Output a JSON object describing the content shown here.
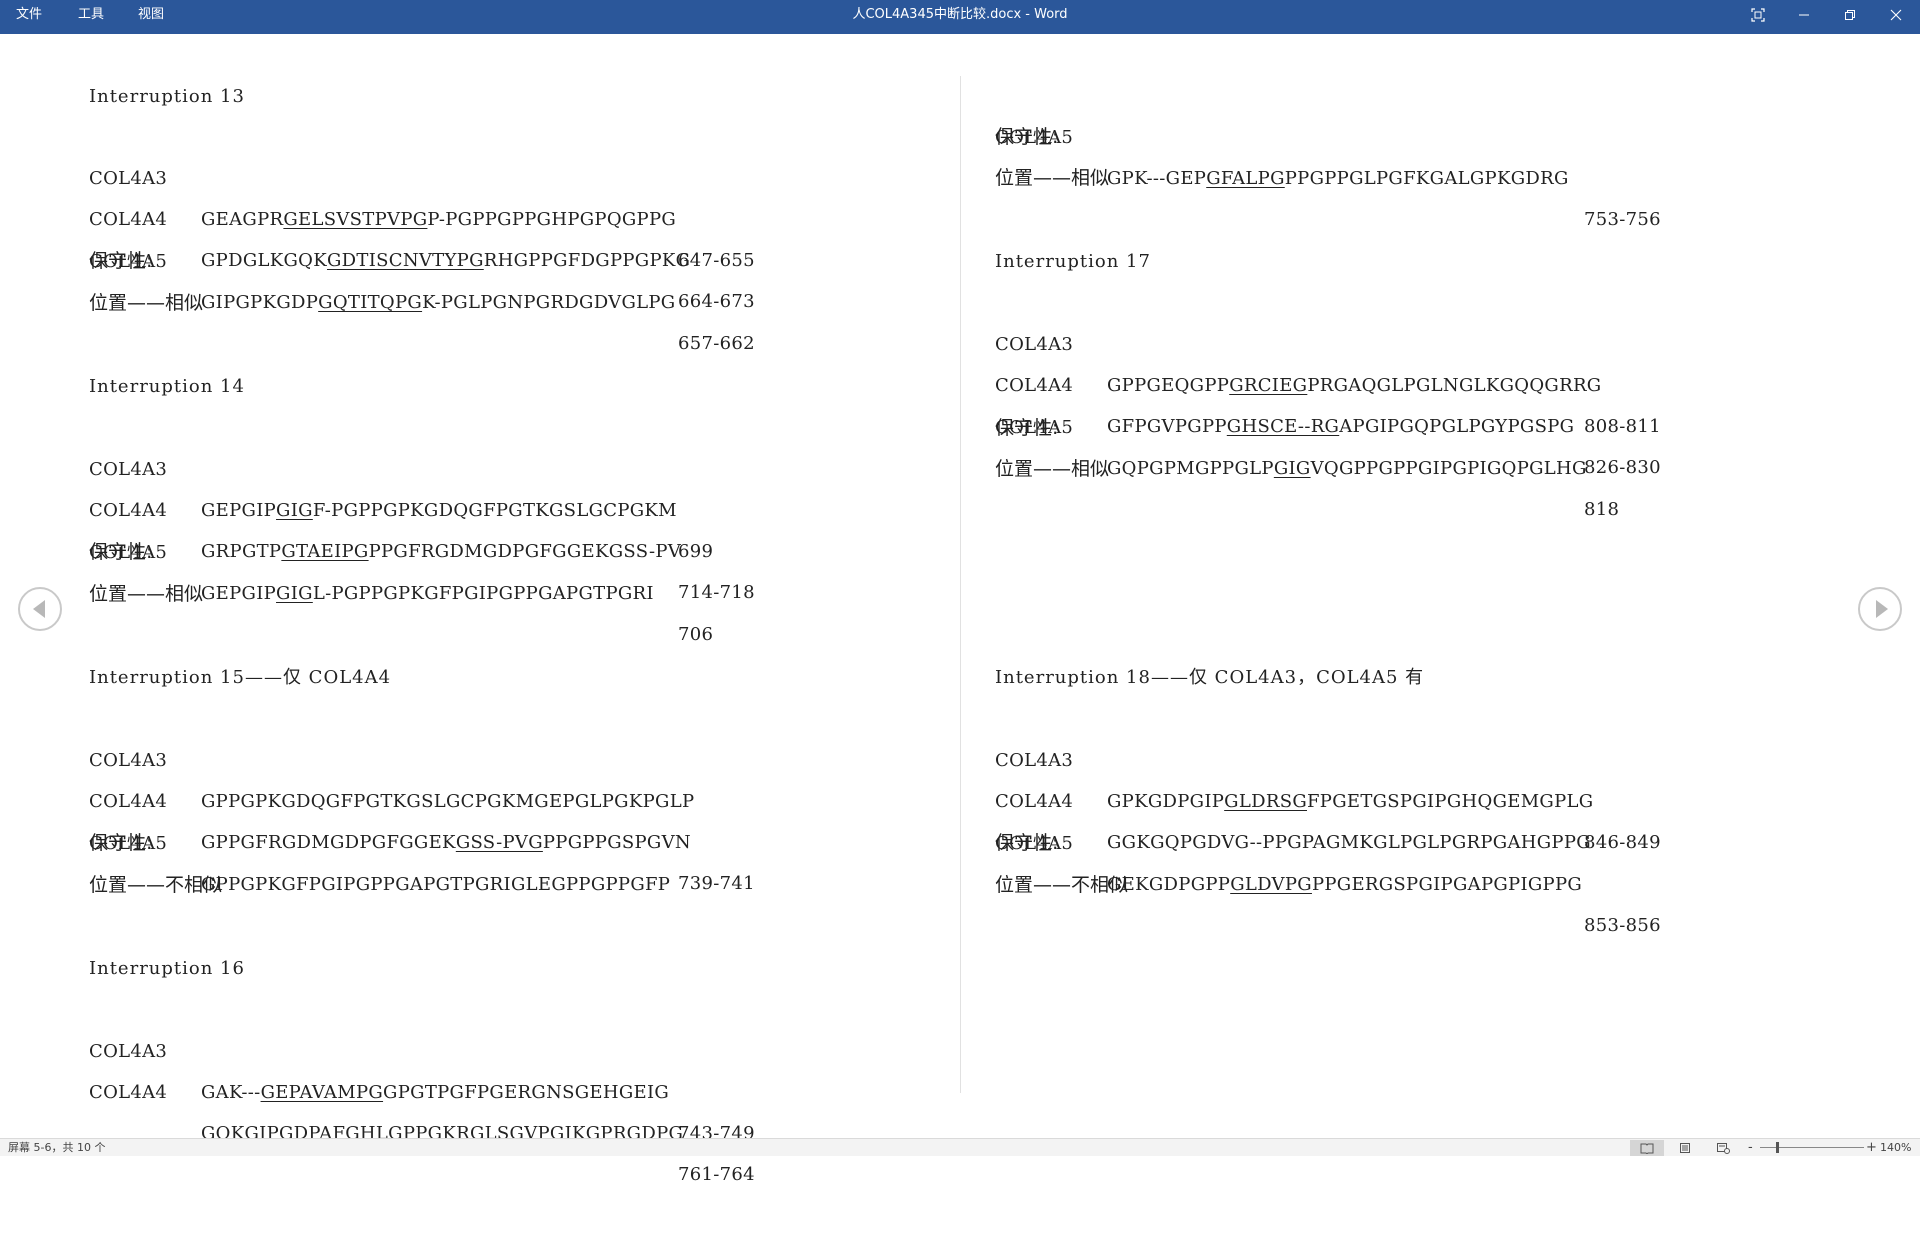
{
  "titlebar": {
    "menus": [
      "文件",
      "工具",
      "视图"
    ],
    "title": "人COL4A345中断比较.docx  -  Word",
    "bg": "#2b579a"
  },
  "left_column": {
    "sections": [
      {
        "heading": "Interruption 13",
        "rows": [
          {
            "gene": "COL4A3",
            "pre": "GEAGPR",
            "ul": "GELSVSTPVPG",
            "post": "P-PGPPGPPGHPGPQGPPG",
            "range": "647-655"
          },
          {
            "gene": "COL4A4",
            "pre": "GPDGLKGQK",
            "ul": "GDTISCNVTYPG",
            "post": "RHGPPGFDGPPGPKG",
            "range": "664-673"
          },
          {
            "gene": "COL4A5",
            "pre": "GIPGPKGDP",
            "ul": "GQTITQPG",
            "post": "K-PGLPGNPGRDGDVGLPG",
            "range": "657-662"
          }
        ],
        "conservation": "保守性:",
        "position": "位置——相似"
      },
      {
        "heading": "Interruption 14",
        "rows": [
          {
            "gene": "COL4A3",
            "pre": "GEPGIP",
            "ul": "GIG",
            "post": "F-PGPPGPKGDQGFPGTKGSLGCPGKM",
            "range": "699"
          },
          {
            "gene": "COL4A4",
            "pre": "GRPGTP",
            "ul": "GTAEIPG",
            "post": "PPGFRGDMGDPGFGGEKGSS-PV",
            "range": "714-718"
          },
          {
            "gene": "COL4A5",
            "pre": "GEPGIP",
            "ul": "GIG",
            "post": "L-PGPPGPKGFPGIPGPPGAPGTPGRI",
            "range": "706"
          }
        ],
        "conservation": "保守性:",
        "position": "位置——相似"
      },
      {
        "heading": "Interruption 15——仅 COL4A4",
        "rows": [
          {
            "gene": "COL4A3",
            "pre": "GPPGPKGDQGFPGTKGSLGCPGKMGEPGLPGKPGLP",
            "ul": "",
            "post": "",
            "range": ""
          },
          {
            "gene": "COL4A4",
            "pre": "GPPGFRGDMGDPGFGGEK",
            "ul": "GSS-PVG",
            "post": "PPGPPGSPGVN",
            "range": "739-741"
          },
          {
            "gene": "COL4A5",
            "pre": "GPPGPKGFPGIPGPPGAPGTPGRIGLEGPPGPPGFP",
            "ul": "",
            "post": "",
            "range": ""
          }
        ],
        "conservation": "保守性:",
        "position": "位置——不相似"
      },
      {
        "heading": "Interruption 16",
        "rows": [
          {
            "gene": "COL4A3",
            "pre": "GAK---",
            "ul": "GEPAVAMPG",
            "post": "GPGTPGFPGERGNSGEHGEIG",
            "range": "743-749"
          },
          {
            "gene": "COL4A4",
            "pre": "GQKGIP",
            "ul": "GDPAFG",
            "post": "HLGPPGKRGLSGVPGIKGPRGDPG",
            "range": "761-764"
          }
        ]
      }
    ]
  },
  "right_column": {
    "top_row": {
      "gene": "COL4A5",
      "pre": "GPK---GEP",
      "ul": "GFALPG",
      "post": "PPGPPGLPGFKGALGPKGDRG",
      "range": "753-756"
    },
    "top_conservation": "保守性:",
    "top_position": "位置——相似",
    "sections": [
      {
        "heading": "Interruption 17",
        "rows": [
          {
            "gene": "COL4A3",
            "pre": "GPPGEQGPP",
            "ul": "GRCIEG",
            "post": "PRGAQGLPGLNGLKGQQGRRG",
            "range": "808-811"
          },
          {
            "gene": "COL4A4",
            "pre": "GFPGVPGPP",
            "ul": "GHSCE--RG",
            "post": "APGIPGQPGLPGYPGSPG",
            "range": "826-830"
          },
          {
            "gene": "COL4A5",
            "pre": "GQPGPMGPPGLP",
            "ul": "GIG",
            "post": "VQGPPGPPGIPGPIGQPGLHG",
            "range": "818"
          }
        ],
        "conservation": "保守性:",
        "position": "位置——相似"
      },
      {
        "heading": "Interruption 18——仅 COL4A3，COL4A5 有",
        "rows": [
          {
            "gene": "COL4A3",
            "pre": "GPKGDPGIP",
            "ul": "GLDRSG",
            "post": "FPGETGSPGIPGHQGEMGPLG",
            "range": "846-849"
          },
          {
            "gene": "COL4A4",
            "pre": "GGKGQPGDVG--PPGPAGMKGLPGLPGRPGAHGPPG",
            "ul": "",
            "post": "",
            "range": ""
          },
          {
            "gene": "COL4A5",
            "pre": "GEKGDPGPP",
            "ul": "GLDVPG",
            "post": "PPGERGSPGIPGAPGPIGPPG",
            "range": "853-856"
          }
        ],
        "conservation": "保守性:",
        "position": "位置——不相似"
      }
    ]
  },
  "statusbar": {
    "page_info": "屏幕 5-6，共 10 个",
    "zoom_minus": "-",
    "zoom_plus": "+",
    "zoom": "140%",
    "zoom_level_percent": 140
  }
}
